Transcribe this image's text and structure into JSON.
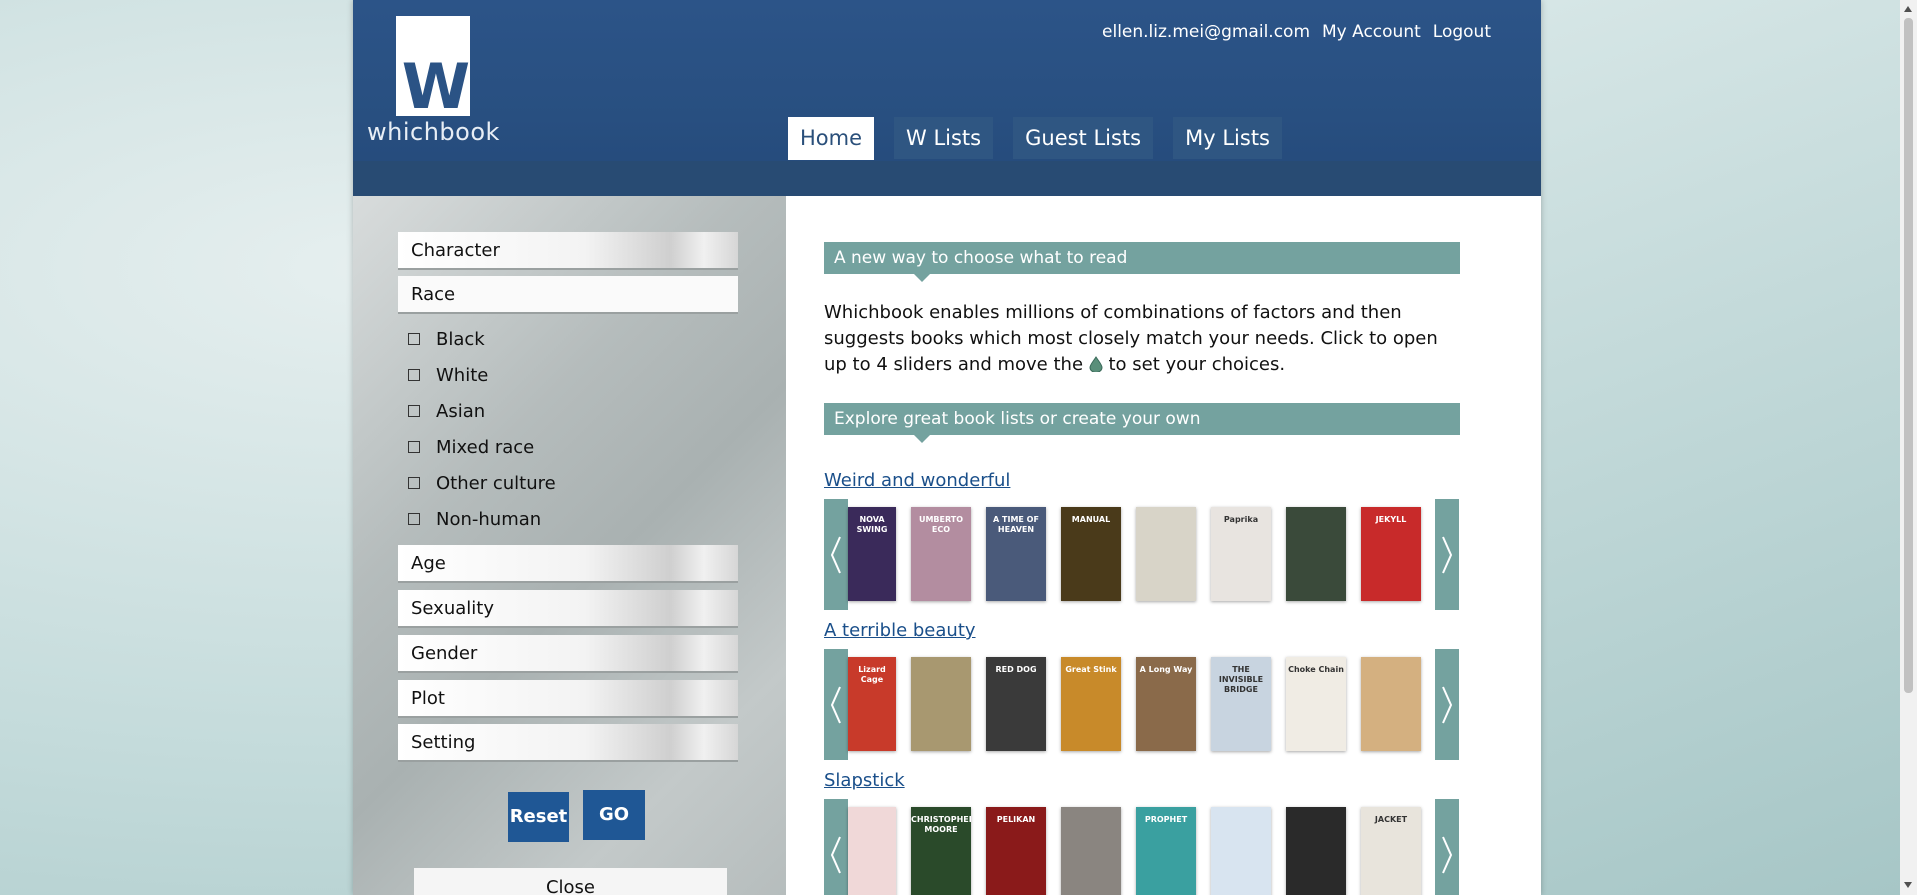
{
  "header": {
    "logo_text": "whichbook",
    "user_email": "ellen.liz.mei@gmail.com",
    "my_account": "My Account",
    "logout": "Logout",
    "tabs": [
      {
        "label": "Home",
        "active": true
      },
      {
        "label": "W Lists",
        "active": false
      },
      {
        "label": "Guest Lists",
        "active": false
      },
      {
        "label": "My Lists",
        "active": false
      }
    ]
  },
  "sidebar": {
    "categories": {
      "character": "Character",
      "race": "Race",
      "age": "Age",
      "sexuality": "Sexuality",
      "gender": "Gender",
      "plot": "Plot",
      "setting": "Setting"
    },
    "race_options": [
      "Black",
      "White",
      "Asian",
      "Mixed race",
      "Other culture",
      "Non-human"
    ],
    "reset_label": "Reset",
    "go_label": "GO",
    "close_label": "Close"
  },
  "main": {
    "intro_heading": "A new way to choose what to read",
    "intro_text_1": "Whichbook enables millions of combinations of factors and then suggests books which most closely match your needs. Click to open up to 4 sliders and move the",
    "intro_text_2": "to set your choices.",
    "explore_heading": "Explore great book lists or create your own",
    "lists": [
      {
        "title": "Weird and wonderful",
        "covers": [
          {
            "text": "NOVA SWING",
            "color": "#3a2a5a"
          },
          {
            "text": "UMBERTO ECO",
            "color": "#b38da0"
          },
          {
            "text": "A TIME OF HEAVEN",
            "color": "#4a5a7a"
          },
          {
            "text": "MANUAL",
            "color": "#4a3a1a"
          },
          {
            "text": "",
            "color": "#d8d4c8"
          },
          {
            "text": "Paprika",
            "color": "#e8e4e0"
          },
          {
            "text": "",
            "color": "#3a4a3a"
          },
          {
            "text": "JEKYLL",
            "color": "#c82a2a"
          }
        ]
      },
      {
        "title": "A terrible beauty",
        "covers": [
          {
            "text": "Lizard Cage",
            "color": "#c83a2a"
          },
          {
            "text": "",
            "color": "#a89870"
          },
          {
            "text": "RED DOG",
            "color": "#3a3a3a"
          },
          {
            "text": "Great Stink",
            "color": "#c88a2a"
          },
          {
            "text": "A Long Way",
            "color": "#8a6a4a"
          },
          {
            "text": "THE INVISIBLE BRIDGE",
            "color": "#c8d4e0"
          },
          {
            "text": "Choke Chain",
            "color": "#f0ece4"
          },
          {
            "text": "",
            "color": "#d4b080"
          }
        ]
      },
      {
        "title": "Slapstick",
        "covers": [
          {
            "text": "",
            "color": "#f0d8d8"
          },
          {
            "text": "CHRISTOPHER MOORE",
            "color": "#2a4a2a"
          },
          {
            "text": "PELIKAN",
            "color": "#8a1a1a"
          },
          {
            "text": "",
            "color": "#8a8580"
          },
          {
            "text": "PROPHET",
            "color": "#3aa0a0"
          },
          {
            "text": "",
            "color": "#d8e4f0"
          },
          {
            "text": "",
            "color": "#2a2a2a"
          },
          {
            "text": "JACKET",
            "color": "#e8e4dc"
          }
        ]
      }
    ]
  },
  "colors": {
    "header_blue": "#2c5488",
    "teal_accent": "#74a29f",
    "button_blue": "#1f5795",
    "link_blue": "#1a4f8a"
  }
}
